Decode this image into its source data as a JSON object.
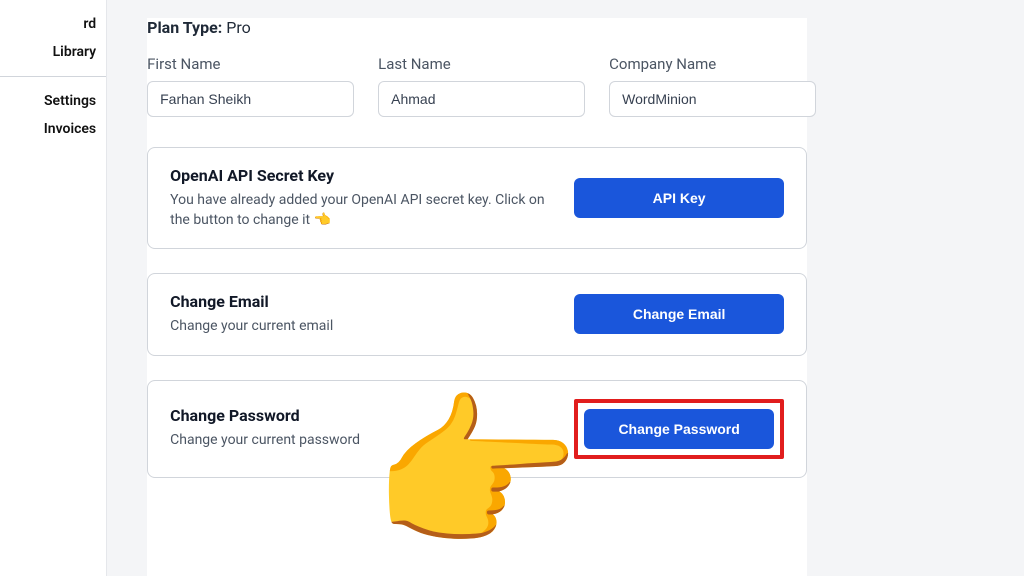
{
  "sidebar": {
    "items": [
      {
        "label": "rd"
      },
      {
        "label": "Library"
      },
      {
        "label": "Settings"
      },
      {
        "label": "Invoices"
      }
    ]
  },
  "plan": {
    "label": "Plan Type:",
    "value": "Pro"
  },
  "fields": {
    "firstName": {
      "label": "First Name",
      "value": "Farhan Sheikh"
    },
    "lastName": {
      "label": "Last Name",
      "value": "Ahmad"
    },
    "companyName": {
      "label": "Company Name",
      "value": "WordMinion"
    }
  },
  "cards": {
    "apiKey": {
      "title": "OpenAI API Secret Key",
      "desc_prefix": "You have already added your OpenAI API secret key. Click on the button to change it ",
      "emoji": "👈",
      "button": "API Key"
    },
    "changeEmail": {
      "title": "Change Email",
      "desc": "Change your current email",
      "button": "Change Email"
    },
    "changePassword": {
      "title": "Change Password",
      "desc": "Change your current password",
      "button": "Change Password"
    }
  },
  "annotation": {
    "pointer_emoji": "👉"
  }
}
